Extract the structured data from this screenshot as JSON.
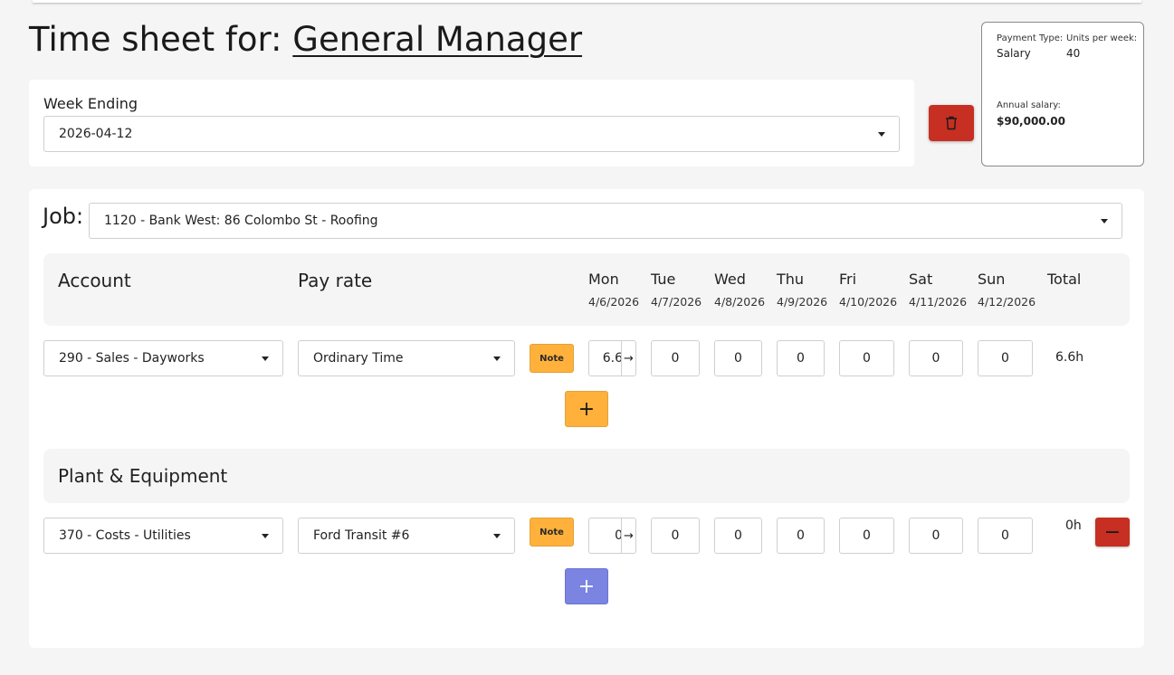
{
  "header": {
    "title_prefix": "Time sheet for:",
    "role": "General Manager"
  },
  "week": {
    "label": "Week Ending",
    "value": "2026-04-12"
  },
  "info": {
    "payment_type_label": "Payment Type:",
    "payment_type": "Salary",
    "units_label": "Units per week:",
    "units": "40",
    "salary_label": "Annual salary:",
    "salary": "$90,000.00"
  },
  "job": {
    "label": "Job:",
    "value": "1120 - Bank West: 86 Colombo St - Roofing"
  },
  "columns": {
    "account": "Account",
    "pay_rate": "Pay rate",
    "total": "Total",
    "days": [
      {
        "name": "Mon",
        "date": "4/6/2026"
      },
      {
        "name": "Tue",
        "date": "4/7/2026"
      },
      {
        "name": "Wed",
        "date": "4/8/2026"
      },
      {
        "name": "Thu",
        "date": "4/9/2026"
      },
      {
        "name": "Fri",
        "date": "4/10/2026"
      },
      {
        "name": "Sat",
        "date": "4/11/2026"
      },
      {
        "name": "Sun",
        "date": "4/12/2026"
      }
    ]
  },
  "labour_row": {
    "account": "290 - Sales - Dayworks",
    "pay_rate": "Ordinary Time",
    "note": "Note",
    "hours": [
      "6.6",
      "0",
      "0",
      "0",
      "0",
      "0",
      "0"
    ],
    "copy_arrow": "→",
    "total": "6.6h"
  },
  "add_label": "+",
  "plant": {
    "title": "Plant & Equipment",
    "row": {
      "account": "370 - Costs - Utilities",
      "item": "Ford Transit #6",
      "note": "Note",
      "hours": [
        "0",
        "0",
        "0",
        "0",
        "0",
        "0",
        "0"
      ],
      "copy_arrow": "→",
      "total": "0h"
    },
    "remove_label": "−"
  },
  "colors": {
    "danger": "#c62f22",
    "warning": "#ffb13b",
    "primary": "#7b84e0"
  },
  "icons": {
    "delete": "trash-icon",
    "dropdown": "caret-down-icon"
  }
}
